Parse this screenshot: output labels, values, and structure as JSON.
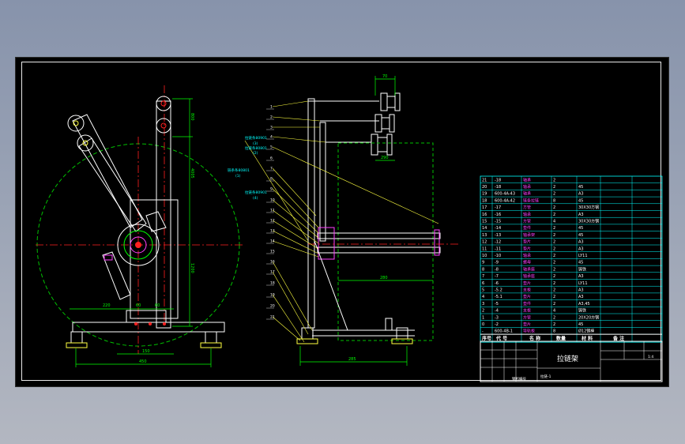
{
  "drawing": {
    "title": "拉链架",
    "sheet_text": "钢机编号",
    "sheet_scale": "1:4",
    "sheet_no": "拉链-1"
  },
  "left_view": {
    "dim_labels": [
      "220",
      "60",
      "60",
      "150",
      "450",
      "4005",
      "1200"
    ],
    "dim_vertical": [
      "800",
      "1100"
    ]
  },
  "side_view": {
    "top_dim": "70",
    "mid_dim": "290",
    "long_dim": "280",
    "base_dim": "285",
    "leader_numbers": [
      "1",
      "2",
      "3",
      "4",
      "5",
      "6",
      "7",
      "8",
      "9",
      "10",
      "11",
      "12",
      "13",
      "14",
      "15",
      "16",
      "17",
      "18",
      "19",
      "20",
      "21"
    ],
    "callouts": [
      {
        "text": "拉链条80901",
        "sub": "(3)"
      },
      {
        "text": "拉链条80801",
        "sub": "(2)"
      },
      {
        "text": "链条条80801",
        "sub": "(1)"
      },
      {
        "text": "拉链条80901",
        "sub": "(4)"
      }
    ]
  },
  "bom": {
    "headers": [
      "序号",
      "代  号",
      "名  称",
      "数量",
      "材  料",
      "备  注"
    ],
    "rows": [
      [
        "21",
        "-18",
        "轴承",
        "2",
        "",
        ""
      ],
      [
        "20",
        "-18",
        "轴承",
        "2",
        "45",
        ""
      ],
      [
        "19",
        "600-4A-43",
        "轴承",
        "2",
        "A3",
        ""
      ],
      [
        "18",
        "600-4A-42",
        "链条拉链",
        "8",
        "45",
        ""
      ],
      [
        "17",
        "-17",
        "方管",
        "2",
        "30X30方钢",
        ""
      ],
      [
        "16",
        "-16",
        "轴承",
        "2",
        "A3",
        ""
      ],
      [
        "15",
        "-15",
        "方管",
        "4",
        "30X30方钢",
        ""
      ],
      [
        "14",
        "-14",
        "垫件",
        "2",
        "45",
        ""
      ],
      [
        "13",
        "-13",
        "轴承架",
        "2",
        "45",
        ""
      ],
      [
        "12",
        "-12",
        "垫片",
        "2",
        "A3",
        ""
      ],
      [
        "11",
        "-11",
        "垫片",
        "2",
        "A3",
        ""
      ],
      [
        "10",
        "-10",
        "轴承",
        "2",
        "LY11",
        ""
      ],
      [
        "9",
        "-9",
        "螺母",
        "2",
        "45",
        ""
      ],
      [
        "8",
        "-8",
        "轴承座",
        "2",
        "铸铁",
        ""
      ],
      [
        "7",
        "-7",
        "轴承座",
        "2",
        "A3",
        ""
      ],
      [
        "6",
        "-6",
        "垫片",
        "2",
        "LY11",
        ""
      ],
      [
        "5",
        "-5.2",
        "支板",
        "2",
        "A3",
        ""
      ],
      [
        "4",
        "-5.1",
        "垫片",
        "2",
        "A3",
        ""
      ],
      [
        "3",
        "-5",
        "垫件",
        "2",
        "A3,45",
        ""
      ],
      [
        "2",
        "-4",
        "支板",
        "4",
        "铸铁",
        ""
      ],
      [
        "1",
        "-3",
        "方管",
        "2",
        "20X20方钢",
        ""
      ],
      [
        "0",
        "-2",
        "垫片",
        "2",
        "45",
        ""
      ],
      [
        "-",
        "600-4B-1",
        "导轨板",
        "8",
        "Ø12钢棒",
        ""
      ]
    ]
  },
  "colors": {
    "background_top": "#8793ab",
    "sheet": "#000000",
    "outline": "#ffffff",
    "centerline": "#ff2020",
    "dimension": "#00ff00",
    "hidden": "#00c000",
    "leader": "#ffff40",
    "table_line": "#00ffff",
    "accent": "#ff40ff"
  }
}
